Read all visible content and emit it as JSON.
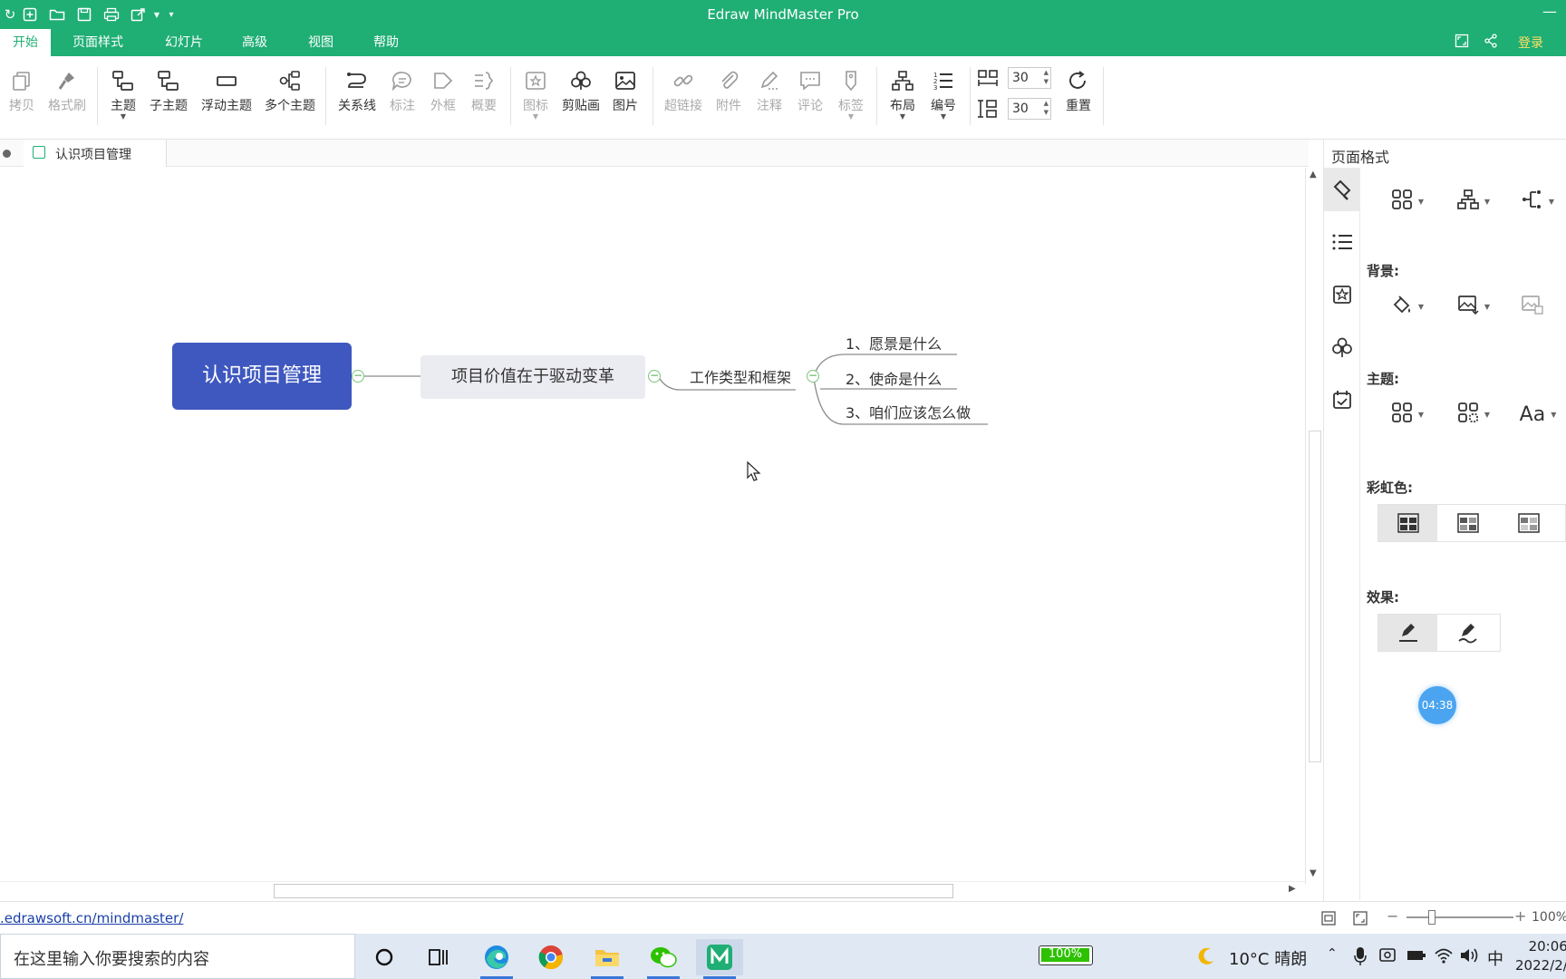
{
  "window": {
    "title": "Edraw MindMaster Pro"
  },
  "menu": {
    "tabs": [
      "开始",
      "页面样式",
      "幻灯片",
      "高级",
      "视图",
      "帮助"
    ],
    "login": "登录"
  },
  "ribbon": {
    "tools": {
      "copy": "拷贝",
      "format_brush": "格式刷",
      "topic": "主题",
      "subtopic": "子主题",
      "floating": "浮动主题",
      "multi": "多个主题",
      "relation": "关系线",
      "callout": "标注",
      "boundary": "外框",
      "summary": "概要",
      "icon": "图标",
      "clipart": "剪贴画",
      "picture": "图片",
      "hyperlink": "超链接",
      "attachment": "附件",
      "note": "注释",
      "comment": "评论",
      "tag": "标签",
      "layout": "布局",
      "numbering": "编号",
      "reset": "重置"
    },
    "spacing_h": "30",
    "spacing_v": "30"
  },
  "document": {
    "tab_title": "认识项目管理"
  },
  "mindmap": {
    "root": "认识项目管理",
    "main": "项目价值在于驱动变革",
    "sub": "工作类型和框架",
    "leaves": [
      "1、愿景是什么",
      "2、使命是什么",
      "3、咱们应该怎么做"
    ]
  },
  "panel": {
    "title": "页面格式",
    "background_label": "背景:",
    "theme_label": "主题:",
    "rainbow_label": "彩虹色:",
    "effect_label": "效果:",
    "timer": "04:38"
  },
  "status": {
    "url": ".edrawsoft.cn/mindmaster/",
    "zoom": "100%"
  },
  "taskbar": {
    "search_placeholder": "在这里输入你要搜索的内容",
    "battery": "100%",
    "weather": "10°C 晴朗",
    "ime": "中",
    "time": "20:06",
    "date": "2022/2/"
  },
  "colors": {
    "brand": "#1fae74",
    "root_node": "#3f58c0",
    "main_node": "#ebebf2",
    "timer": "#4aa4f0"
  }
}
